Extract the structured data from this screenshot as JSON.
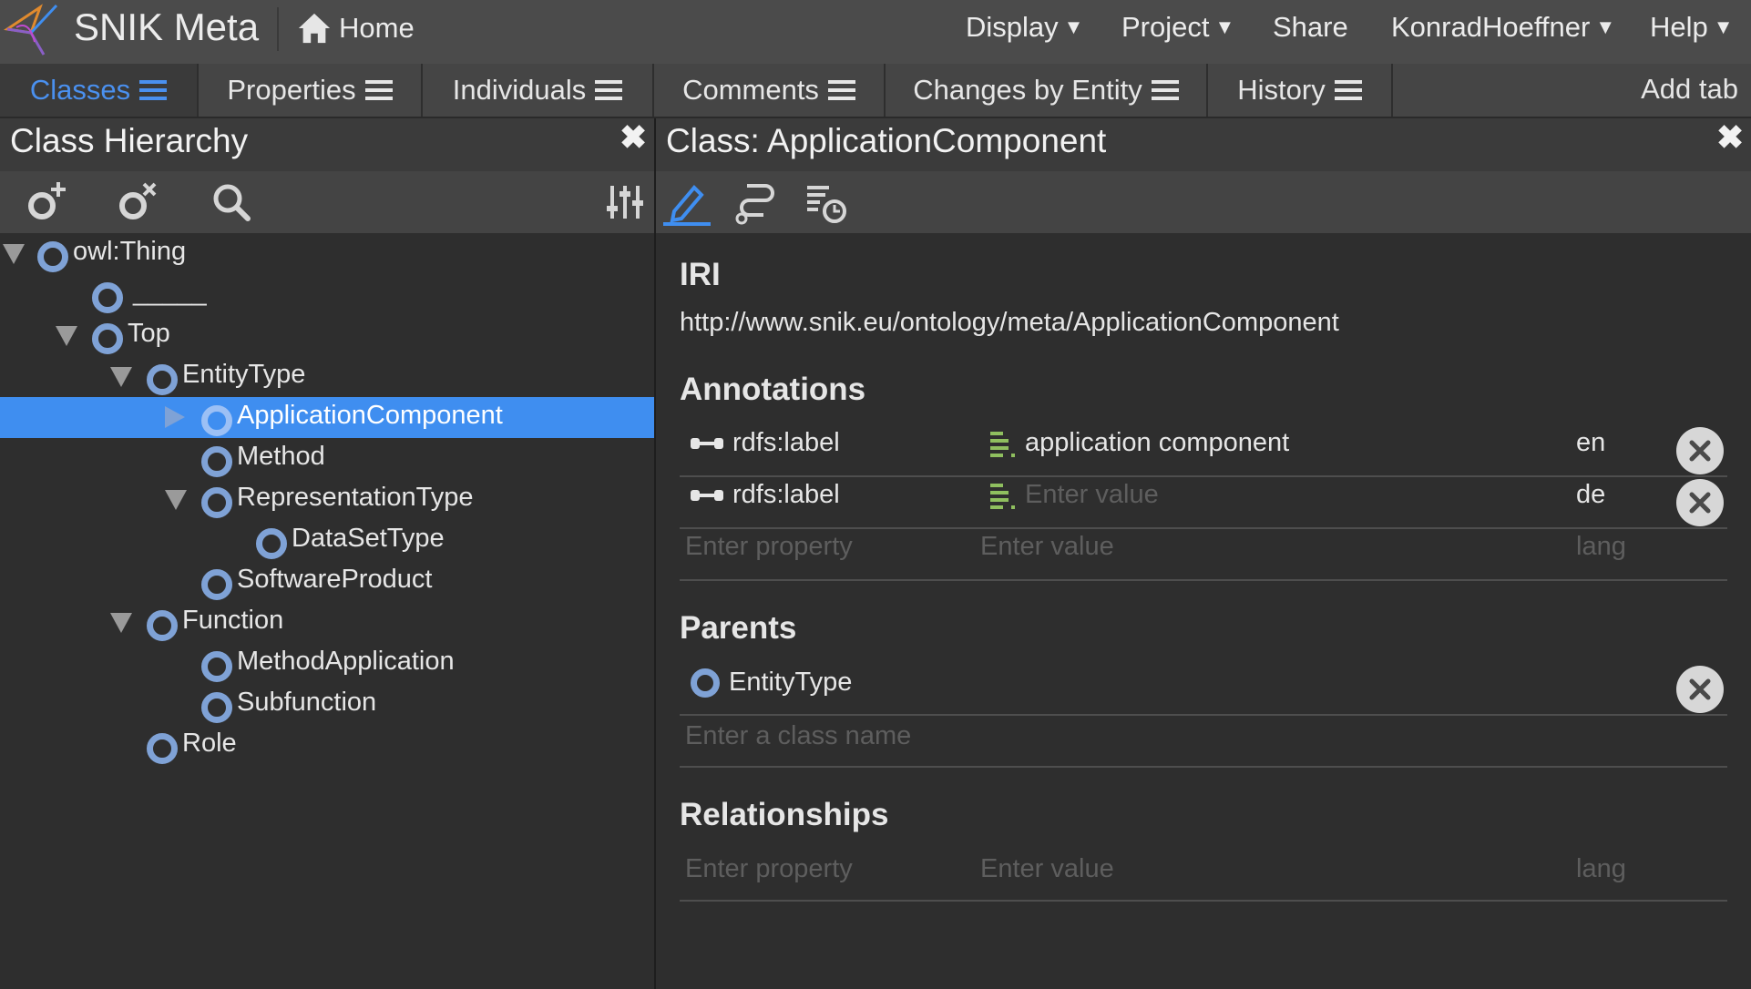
{
  "header": {
    "app_title": "SNIK Meta",
    "home_label": "Home",
    "menus": [
      "Display",
      "Project",
      "Share",
      "KonradHoeffner",
      "Help"
    ]
  },
  "tabs": [
    {
      "label": "Classes",
      "active": true
    },
    {
      "label": "Properties"
    },
    {
      "label": "Individuals"
    },
    {
      "label": "Comments"
    },
    {
      "label": "Changes by Entity"
    },
    {
      "label": "History"
    }
  ],
  "add_tab_label": "Add tab",
  "left_panel": {
    "title": "Class Hierarchy",
    "tree": [
      {
        "label": "owl:Thing"
      },
      {
        "label": "_____"
      },
      {
        "label": "Top"
      },
      {
        "label": "EntityType"
      },
      {
        "label": "ApplicationComponent",
        "selected": true
      },
      {
        "label": "Method"
      },
      {
        "label": "RepresentationType"
      },
      {
        "label": "DataSetType"
      },
      {
        "label": "SoftwareProduct"
      },
      {
        "label": "Function"
      },
      {
        "label": "MethodApplication"
      },
      {
        "label": "Subfunction"
      },
      {
        "label": "Role"
      }
    ]
  },
  "right_panel": {
    "title": "Class: ApplicationComponent",
    "iri_heading": "IRI",
    "iri": "http://www.snik.eu/ontology/meta/ApplicationComponent",
    "annotations_heading": "Annotations",
    "annotations": [
      {
        "property": "rdfs:label",
        "value": "application component",
        "lang": "en"
      },
      {
        "property": "rdfs:label",
        "value_placeholder": "Enter value",
        "lang": "de"
      }
    ],
    "annotation_new": {
      "property_placeholder": "Enter property",
      "value_placeholder": "Enter value",
      "lang_placeholder": "lang"
    },
    "parents_heading": "Parents",
    "parents": [
      "EntityType"
    ],
    "parent_placeholder": "Enter a class name",
    "relationships_heading": "Relationships",
    "relationship_new": {
      "property_placeholder": "Enter property",
      "value_placeholder": "Enter value",
      "lang_placeholder": "lang"
    }
  },
  "colors": {
    "accent": "#3f8ef0",
    "node": "#7fa2d6",
    "annotation_icon": "#8fbf5f"
  }
}
